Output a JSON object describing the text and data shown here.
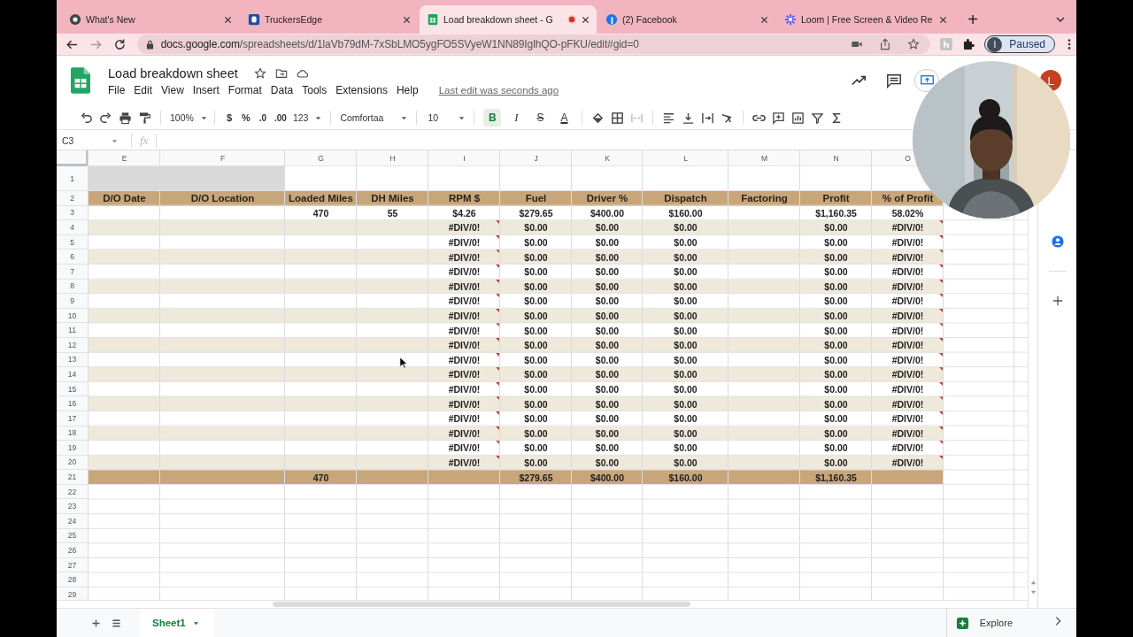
{
  "browser": {
    "tabs": [
      {
        "title": "What's New",
        "selected": false,
        "recording": false
      },
      {
        "title": "TruckersEdge",
        "selected": false,
        "recording": false
      },
      {
        "title": "Load breakdown sheet - G",
        "selected": true,
        "recording": true
      },
      {
        "title": "(2) Facebook",
        "selected": false,
        "recording": false
      },
      {
        "title": "Loom | Free Screen & Video Re",
        "selected": false,
        "recording": false
      }
    ],
    "new_tab": "+",
    "address": {
      "host": "docs.google.com",
      "path": "/spreadsheets/d/1laVb79dM-7xSbLMO5ygFO5SVyeW1NN89IglhQO-pFKU/edit#gid=0"
    },
    "profile": {
      "initial": "I",
      "status": "Paused"
    }
  },
  "doc": {
    "title": "Load breakdown sheet",
    "menus": [
      "File",
      "Edit",
      "View",
      "Insert",
      "Format",
      "Data",
      "Tools",
      "Extensions",
      "Help"
    ],
    "last_edit": "Last edit was seconds ago",
    "avatar": "L"
  },
  "toolbar": {
    "zoom": "100%",
    "currency": "$",
    "percent": "%",
    "decrease_decimals": ".0",
    "increase_decimals": ".00",
    "number_format": "123",
    "font": "Comfortaa",
    "font_size": "10",
    "styles": [
      {
        "label": "B",
        "kind": "bold",
        "on": true
      },
      {
        "label": "I",
        "kind": "italic",
        "on": false
      },
      {
        "label": "S",
        "kind": "strike",
        "on": false
      },
      {
        "label": "A",
        "kind": "color",
        "on": false
      }
    ]
  },
  "formula_bar": {
    "cell": "C3",
    "fx": "fx"
  },
  "sheet": {
    "columns": [
      "E",
      "F",
      "G",
      "H",
      "I",
      "J",
      "K",
      "L",
      "M",
      "N",
      "O"
    ],
    "rows": [
      {
        "num": "1",
        "kind": "merged"
      },
      {
        "num": "2",
        "kind": "header",
        "cells": [
          "D/O Date",
          "D/O Location",
          "Loaded Miles",
          "DH Miles",
          "RPM $",
          "Fuel",
          "Driver %",
          "Dispatch",
          "Factoring",
          "Profit",
          "% of Profit"
        ]
      },
      {
        "num": "3",
        "kind": "data",
        "banded": false,
        "cells": [
          "",
          "",
          "470",
          "55",
          "$4.26",
          "$279.65",
          "$400.00",
          "$160.00",
          "",
          "$1,160.35",
          "58.02%"
        ]
      },
      {
        "num": "4",
        "kind": "data",
        "banded": true,
        "cells": [
          "",
          "",
          "",
          "",
          {
            "text": "#DIV/0!",
            "flagged": true
          },
          "$0.00",
          "$0.00",
          "$0.00",
          "",
          "$0.00",
          {
            "text": "#DIV/0!",
            "flagged": true
          }
        ]
      },
      {
        "num": "5",
        "kind": "data",
        "banded": false,
        "cells": [
          "",
          "",
          "",
          "",
          {
            "text": "#DIV/0!",
            "flagged": true
          },
          "$0.00",
          "$0.00",
          "$0.00",
          "",
          "$0.00",
          {
            "text": "#DIV/0!",
            "flagged": true
          }
        ]
      },
      {
        "num": "6",
        "kind": "data",
        "banded": true,
        "cells": [
          "",
          "",
          "",
          "",
          {
            "text": "#DIV/0!",
            "flagged": true
          },
          "$0.00",
          "$0.00",
          "$0.00",
          "",
          "$0.00",
          {
            "text": "#DIV/0!",
            "flagged": true
          }
        ]
      },
      {
        "num": "7",
        "kind": "data",
        "banded": false,
        "cells": [
          "",
          "",
          "",
          "",
          {
            "text": "#DIV/0!",
            "flagged": true
          },
          "$0.00",
          "$0.00",
          "$0.00",
          "",
          "$0.00",
          {
            "text": "#DIV/0!",
            "flagged": true
          }
        ]
      },
      {
        "num": "8",
        "kind": "data",
        "banded": true,
        "cells": [
          "",
          "",
          "",
          "",
          {
            "text": "#DIV/0!",
            "flagged": true
          },
          "$0.00",
          "$0.00",
          "$0.00",
          "",
          "$0.00",
          {
            "text": "#DIV/0!",
            "flagged": true
          }
        ]
      },
      {
        "num": "9",
        "kind": "data",
        "banded": false,
        "cells": [
          "",
          "",
          "",
          "",
          {
            "text": "#DIV/0!",
            "flagged": true
          },
          "$0.00",
          "$0.00",
          "$0.00",
          "",
          "$0.00",
          {
            "text": "#DIV/0!",
            "flagged": true
          }
        ]
      },
      {
        "num": "10",
        "kind": "data",
        "banded": true,
        "cells": [
          "",
          "",
          "",
          "",
          {
            "text": "#DIV/0!",
            "flagged": true
          },
          "$0.00",
          "$0.00",
          "$0.00",
          "",
          "$0.00",
          {
            "text": "#DIV/0!",
            "flagged": true
          }
        ]
      },
      {
        "num": "11",
        "kind": "data",
        "banded": false,
        "cells": [
          "",
          "",
          "",
          "",
          {
            "text": "#DIV/0!",
            "flagged": true
          },
          "$0.00",
          "$0.00",
          "$0.00",
          "",
          "$0.00",
          {
            "text": "#DIV/0!",
            "flagged": true
          }
        ]
      },
      {
        "num": "12",
        "kind": "data",
        "banded": true,
        "cells": [
          "",
          "",
          "",
          "",
          {
            "text": "#DIV/0!",
            "flagged": true
          },
          "$0.00",
          "$0.00",
          "$0.00",
          "",
          "$0.00",
          {
            "text": "#DIV/0!",
            "flagged": true
          }
        ]
      },
      {
        "num": "13",
        "kind": "data",
        "banded": false,
        "cells": [
          "",
          "",
          "",
          "",
          {
            "text": "#DIV/0!",
            "flagged": true
          },
          "$0.00",
          "$0.00",
          "$0.00",
          "",
          "$0.00",
          {
            "text": "#DIV/0!",
            "flagged": true
          }
        ]
      },
      {
        "num": "14",
        "kind": "data",
        "banded": true,
        "cells": [
          "",
          "",
          "",
          "",
          {
            "text": "#DIV/0!",
            "flagged": true
          },
          "$0.00",
          "$0.00",
          "$0.00",
          "",
          "$0.00",
          {
            "text": "#DIV/0!",
            "flagged": true
          }
        ]
      },
      {
        "num": "15",
        "kind": "data",
        "banded": false,
        "cells": [
          "",
          "",
          "",
          "",
          {
            "text": "#DIV/0!",
            "flagged": true
          },
          "$0.00",
          "$0.00",
          "$0.00",
          "",
          "$0.00",
          {
            "text": "#DIV/0!",
            "flagged": true
          }
        ]
      },
      {
        "num": "16",
        "kind": "data",
        "banded": true,
        "cells": [
          "",
          "",
          "",
          "",
          {
            "text": "#DIV/0!",
            "flagged": true
          },
          "$0.00",
          "$0.00",
          "$0.00",
          "",
          "$0.00",
          {
            "text": "#DIV/0!",
            "flagged": true
          }
        ]
      },
      {
        "num": "17",
        "kind": "data",
        "banded": false,
        "cells": [
          "",
          "",
          "",
          "",
          {
            "text": "#DIV/0!",
            "flagged": true
          },
          "$0.00",
          "$0.00",
          "$0.00",
          "",
          "$0.00",
          {
            "text": "#DIV/0!",
            "flagged": true
          }
        ]
      },
      {
        "num": "18",
        "kind": "data",
        "banded": true,
        "cells": [
          "",
          "",
          "",
          "",
          {
            "text": "#DIV/0!",
            "flagged": true
          },
          "$0.00",
          "$0.00",
          "$0.00",
          "",
          "$0.00",
          {
            "text": "#DIV/0!",
            "flagged": true
          }
        ]
      },
      {
        "num": "19",
        "kind": "data",
        "banded": false,
        "cells": [
          "",
          "",
          "",
          "",
          {
            "text": "#DIV/0!",
            "flagged": true
          },
          "$0.00",
          "$0.00",
          "$0.00",
          "",
          "$0.00",
          {
            "text": "#DIV/0!",
            "flagged": true
          }
        ]
      },
      {
        "num": "20",
        "kind": "data",
        "banded": true,
        "cells": [
          "",
          "",
          "",
          "",
          {
            "text": "#DIV/0!",
            "flagged": true
          },
          "$0.00",
          "$0.00",
          "$0.00",
          "",
          "$0.00",
          {
            "text": "#DIV/0!",
            "flagged": true
          }
        ]
      },
      {
        "num": "21",
        "kind": "total",
        "cells": [
          "",
          "",
          "470",
          "",
          "",
          "$279.65",
          "$400.00",
          "$160.00",
          "",
          "$1,160.35",
          ""
        ]
      },
      {
        "num": "22",
        "kind": "empty"
      },
      {
        "num": "23",
        "kind": "empty"
      },
      {
        "num": "24",
        "kind": "empty"
      },
      {
        "num": "25",
        "kind": "empty"
      },
      {
        "num": "26",
        "kind": "empty"
      },
      {
        "num": "27",
        "kind": "empty"
      },
      {
        "num": "28",
        "kind": "empty"
      },
      {
        "num": "29",
        "kind": "empty"
      }
    ]
  },
  "sheet_tabs": [
    {
      "label": "Sheet1",
      "selected": true
    }
  ],
  "explore": "Explore"
}
